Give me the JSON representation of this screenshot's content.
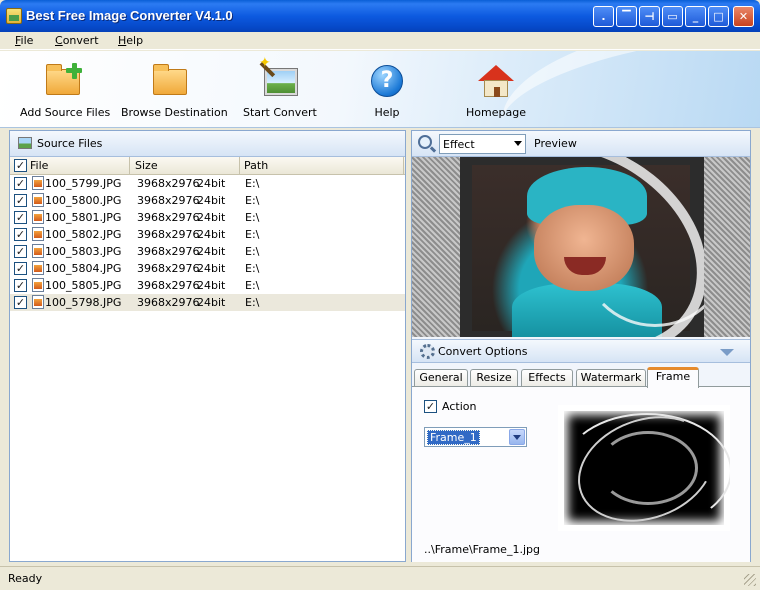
{
  "window": {
    "title": "Best Free Image Converter V4.1.0"
  },
  "menu": {
    "file": {
      "u": "F",
      "rest": "ile"
    },
    "convert": {
      "u": "C",
      "rest": "onvert"
    },
    "help": {
      "u": "H",
      "rest": "elp"
    }
  },
  "toolbar": {
    "add_source": "Add Source Files",
    "browse_destination": "Browse Destination",
    "start_convert": "Start Convert",
    "help": "Help",
    "homepage": "Homepage"
  },
  "source_panel": {
    "title": "Source Files",
    "columns": {
      "file": "File",
      "size": "Size",
      "path": "Path"
    },
    "rows": [
      {
        "file": "100_5799.JPG",
        "size": "3968x2976",
        "depth": "24bit",
        "path": "E:\\",
        "checked": true
      },
      {
        "file": "100_5800.JPG",
        "size": "3968x2976",
        "depth": "24bit",
        "path": "E:\\",
        "checked": true
      },
      {
        "file": "100_5801.JPG",
        "size": "3968x2976",
        "depth": "24bit",
        "path": "E:\\",
        "checked": true
      },
      {
        "file": "100_5802.JPG",
        "size": "3968x2976",
        "depth": "24bit",
        "path": "E:\\",
        "checked": true
      },
      {
        "file": "100_5803.JPG",
        "size": "3968x2976",
        "depth": "24bit",
        "path": "E:\\",
        "checked": true
      },
      {
        "file": "100_5804.JPG",
        "size": "3968x2976",
        "depth": "24bit",
        "path": "E:\\",
        "checked": true
      },
      {
        "file": "100_5805.JPG",
        "size": "3968x2976",
        "depth": "24bit",
        "path": "E:\\",
        "checked": true
      },
      {
        "file": "100_5798.JPG",
        "size": "3968x2976",
        "depth": "24bit",
        "path": "E:\\",
        "checked": true
      }
    ]
  },
  "preview": {
    "effect_value": "Effect",
    "title": "Preview"
  },
  "convert_options": {
    "title": "Convert Options",
    "tabs": [
      "General",
      "Resize",
      "Effects",
      "Watermark",
      "Frame"
    ],
    "active_tab": "Frame",
    "frame": {
      "action_label": "Action",
      "action_checked": true,
      "frame_value": "Frame_1",
      "frame_path": "..\\Frame\\Frame_1.jpg"
    }
  },
  "status": {
    "text": "Ready"
  }
}
